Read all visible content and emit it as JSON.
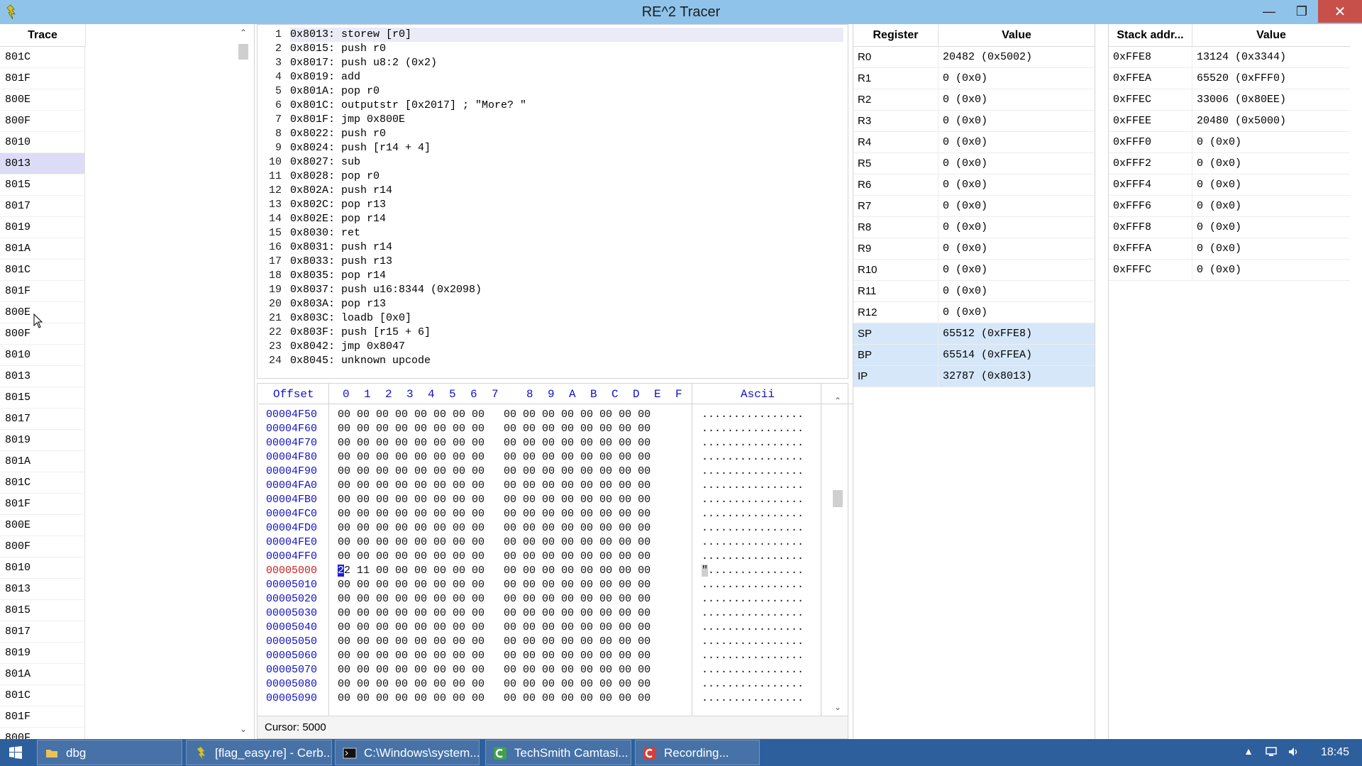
{
  "window": {
    "title": "RE^2 Tracer"
  },
  "trace": {
    "header": "Trace",
    "items": [
      "801C",
      "801F",
      "800E",
      "800F",
      "8010",
      "8013",
      "8015",
      "8017",
      "8019",
      "801A",
      "801C",
      "801F",
      "800E",
      "800F",
      "8010",
      "8013",
      "8015",
      "8017",
      "8019",
      "801A",
      "801C",
      "801F",
      "800E",
      "800F",
      "8010",
      "8013",
      "8015",
      "8017",
      "8019",
      "801A",
      "801C",
      "801F",
      "800F"
    ],
    "selected_index": 5
  },
  "code": {
    "current_line": 1,
    "lines": [
      {
        "n": "1",
        "text": "0x8013: storew [r0]"
      },
      {
        "n": "2",
        "text": "0x8015: push r0"
      },
      {
        "n": "3",
        "text": "0x8017: push u8:2 (0x2)"
      },
      {
        "n": "4",
        "text": "0x8019: add"
      },
      {
        "n": "5",
        "text": "0x801A: pop r0"
      },
      {
        "n": "6",
        "text": "0x801C: outputstr [0x2017] ; \"More? \""
      },
      {
        "n": "7",
        "text": "0x801F: jmp 0x800E"
      },
      {
        "n": "8",
        "text": "0x8022: push r0"
      },
      {
        "n": "9",
        "text": "0x8024: push [r14 + 4]"
      },
      {
        "n": "10",
        "text": "0x8027: sub"
      },
      {
        "n": "11",
        "text": "0x8028: pop r0"
      },
      {
        "n": "12",
        "text": "0x802A: push r14"
      },
      {
        "n": "13",
        "text": "0x802C: pop r13"
      },
      {
        "n": "14",
        "text": "0x802E: pop r14"
      },
      {
        "n": "15",
        "text": "0x8030: ret"
      },
      {
        "n": "16",
        "text": "0x8031: push r14"
      },
      {
        "n": "17",
        "text": "0x8033: push r13"
      },
      {
        "n": "18",
        "text": "0x8035: pop r14"
      },
      {
        "n": "19",
        "text": "0x8037: push u16:8344 (0x2098)"
      },
      {
        "n": "20",
        "text": "0x803A: pop r13"
      },
      {
        "n": "21",
        "text": "0x803C: loadb [0x0]"
      },
      {
        "n": "22",
        "text": "0x803F: push [r15 + 6]"
      },
      {
        "n": "23",
        "text": "0x8042: jmp 0x8047"
      },
      {
        "n": "24",
        "text": "0x8045: unknown upcode"
      }
    ]
  },
  "hex": {
    "header": {
      "offset": "Offset",
      "cols": [
        "0",
        "1",
        "2",
        "3",
        "4",
        "5",
        "6",
        "7",
        "8",
        "9",
        "A",
        "B",
        "C",
        "D",
        "E",
        "F"
      ],
      "ascii": "Ascii"
    },
    "rows": [
      {
        "offset": "00004F50",
        "bytes": "00 00 00 00 00 00 00 00   00 00 00 00 00 00 00 00",
        "ascii": "................"
      },
      {
        "offset": "00004F60",
        "bytes": "00 00 00 00 00 00 00 00   00 00 00 00 00 00 00 00",
        "ascii": "................"
      },
      {
        "offset": "00004F70",
        "bytes": "00 00 00 00 00 00 00 00   00 00 00 00 00 00 00 00",
        "ascii": "................"
      },
      {
        "offset": "00004F80",
        "bytes": "00 00 00 00 00 00 00 00   00 00 00 00 00 00 00 00",
        "ascii": "................"
      },
      {
        "offset": "00004F90",
        "bytes": "00 00 00 00 00 00 00 00   00 00 00 00 00 00 00 00",
        "ascii": "................"
      },
      {
        "offset": "00004FA0",
        "bytes": "00 00 00 00 00 00 00 00   00 00 00 00 00 00 00 00",
        "ascii": "................"
      },
      {
        "offset": "00004FB0",
        "bytes": "00 00 00 00 00 00 00 00   00 00 00 00 00 00 00 00",
        "ascii": "................"
      },
      {
        "offset": "00004FC0",
        "bytes": "00 00 00 00 00 00 00 00   00 00 00 00 00 00 00 00",
        "ascii": "................"
      },
      {
        "offset": "00004FD0",
        "bytes": "00 00 00 00 00 00 00 00   00 00 00 00 00 00 00 00",
        "ascii": "................"
      },
      {
        "offset": "00004FE0",
        "bytes": "00 00 00 00 00 00 00 00   00 00 00 00 00 00 00 00",
        "ascii": "................"
      },
      {
        "offset": "00004FF0",
        "bytes": "00 00 00 00 00 00 00 00   00 00 00 00 00 00 00 00",
        "ascii": "................"
      },
      {
        "offset": "00005000",
        "bytes": "2 11 00 00 00 00 00 00   00 00 00 00 00 00 00 00",
        "ascii": "...............",
        "caret_byte": "2",
        "caret_ascii": "\"",
        "current": true
      },
      {
        "offset": "00005010",
        "bytes": "00 00 00 00 00 00 00 00   00 00 00 00 00 00 00 00",
        "ascii": "................"
      },
      {
        "offset": "00005020",
        "bytes": "00 00 00 00 00 00 00 00   00 00 00 00 00 00 00 00",
        "ascii": "................"
      },
      {
        "offset": "00005030",
        "bytes": "00 00 00 00 00 00 00 00   00 00 00 00 00 00 00 00",
        "ascii": "................"
      },
      {
        "offset": "00005040",
        "bytes": "00 00 00 00 00 00 00 00   00 00 00 00 00 00 00 00",
        "ascii": "................"
      },
      {
        "offset": "00005050",
        "bytes": "00 00 00 00 00 00 00 00   00 00 00 00 00 00 00 00",
        "ascii": "................"
      },
      {
        "offset": "00005060",
        "bytes": "00 00 00 00 00 00 00 00   00 00 00 00 00 00 00 00",
        "ascii": "................"
      },
      {
        "offset": "00005070",
        "bytes": "00 00 00 00 00 00 00 00   00 00 00 00 00 00 00 00",
        "ascii": "................"
      },
      {
        "offset": "00005080",
        "bytes": "00 00 00 00 00 00 00 00   00 00 00 00 00 00 00 00",
        "ascii": "................"
      },
      {
        "offset": "00005090",
        "bytes": "00 00 00 00 00 00 00 00   00 00 00 00 00 00 00 00",
        "ascii": "................"
      }
    ],
    "status": "Cursor: 5000"
  },
  "registers": {
    "header_name": "Register",
    "header_value": "Value",
    "rows": [
      {
        "name": "R0",
        "value": "20482 (0x5002)"
      },
      {
        "name": "R1",
        "value": "0 (0x0)"
      },
      {
        "name": "R2",
        "value": "0 (0x0)"
      },
      {
        "name": "R3",
        "value": "0 (0x0)"
      },
      {
        "name": "R4",
        "value": "0 (0x0)"
      },
      {
        "name": "R5",
        "value": "0 (0x0)"
      },
      {
        "name": "R6",
        "value": "0 (0x0)"
      },
      {
        "name": "R7",
        "value": "0 (0x0)"
      },
      {
        "name": "R8",
        "value": "0 (0x0)"
      },
      {
        "name": "R9",
        "value": "0 (0x0)"
      },
      {
        "name": "R10",
        "value": "0 (0x0)"
      },
      {
        "name": "R11",
        "value": "0 (0x0)"
      },
      {
        "name": "R12",
        "value": "0 (0x0)"
      },
      {
        "name": "SP",
        "value": "65512 (0xFFE8)",
        "hl": true
      },
      {
        "name": "BP",
        "value": "65514 (0xFFEA)",
        "hl": true
      },
      {
        "name": "IP",
        "value": "32787 (0x8013)",
        "hl": true
      }
    ]
  },
  "stack": {
    "header_addr": "Stack addr...",
    "header_value": "Value",
    "rows": [
      {
        "addr": "0xFFE8",
        "value": "13124 (0x3344)"
      },
      {
        "addr": "0xFFEA",
        "value": "65520 (0xFFF0)"
      },
      {
        "addr": "0xFFEC",
        "value": "33006 (0x80EE)"
      },
      {
        "addr": "0xFFEE",
        "value": "20480 (0x5000)"
      },
      {
        "addr": "0xFFF0",
        "value": "0 (0x0)"
      },
      {
        "addr": "0xFFF2",
        "value": "0 (0x0)"
      },
      {
        "addr": "0xFFF4",
        "value": "0 (0x0)"
      },
      {
        "addr": "0xFFF6",
        "value": "0 (0x0)"
      },
      {
        "addr": "0xFFF8",
        "value": "0 (0x0)"
      },
      {
        "addr": "0xFFFA",
        "value": "0 (0x0)"
      },
      {
        "addr": "0xFFFC",
        "value": "0 (0x0)"
      }
    ]
  },
  "taskbar": {
    "items": [
      {
        "label": "dbg",
        "icon": "folder-icon"
      },
      {
        "label": "[flag_easy.re] - Cerb...",
        "icon": "cerberus-icon"
      },
      {
        "label": "C:\\Windows\\system...",
        "icon": "console-icon"
      },
      {
        "label": "TechSmith Camtasi...",
        "icon": "camtasia-icon"
      },
      {
        "label": "Recording...",
        "icon": "recording-icon"
      }
    ],
    "clock": "18:45"
  },
  "colors": {
    "titlebar": "#8fc3ea",
    "taskbar": "#2d5f9c",
    "close_button": "#c7504b",
    "selection": "#dcdcf7",
    "register_highlight": "#d6e7f9",
    "offset_text": "#1010c8",
    "current_offset_text": "#d02020"
  }
}
